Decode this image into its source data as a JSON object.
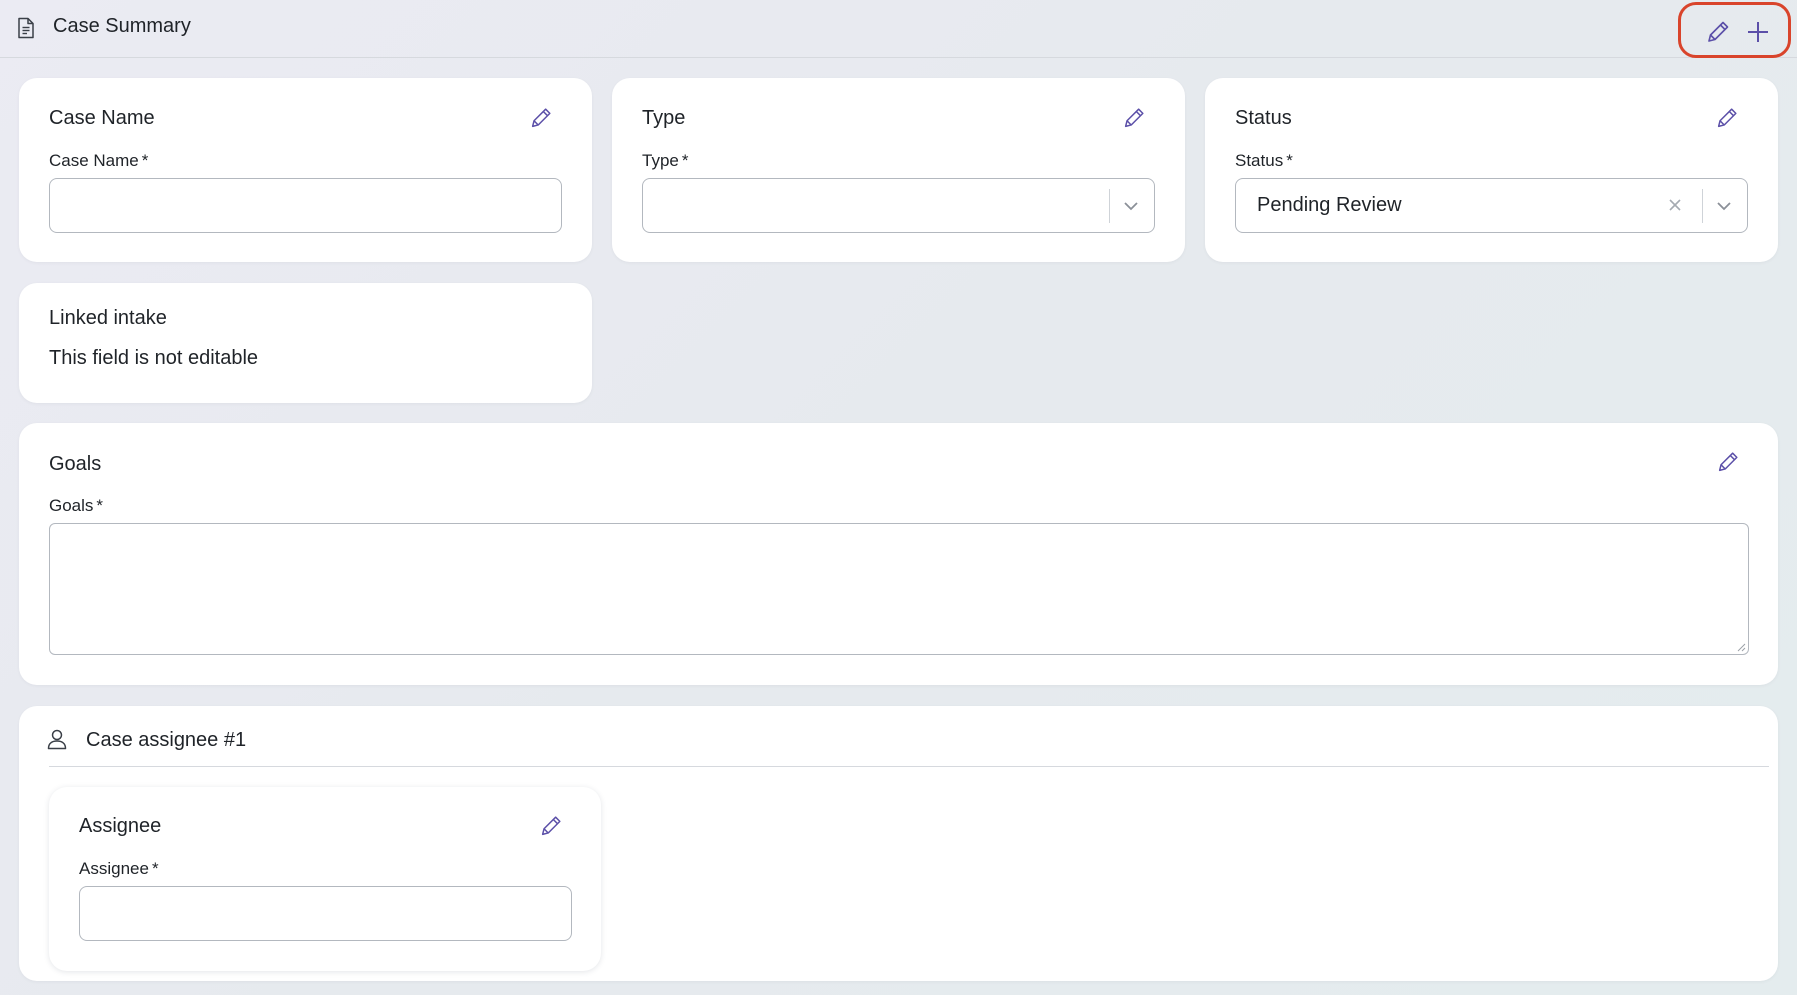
{
  "header": {
    "title": "Case Summary",
    "icons": {
      "document": "document-icon",
      "edit": "pencil-icon",
      "add": "plus-icon"
    }
  },
  "cards": {
    "case_name": {
      "title": "Case Name",
      "label": "Case Name",
      "required": "*",
      "value": ""
    },
    "type": {
      "title": "Type",
      "label": "Type",
      "required": "*",
      "value": ""
    },
    "status": {
      "title": "Status",
      "label": "Status",
      "required": "*",
      "value": "Pending Review"
    },
    "linked_intake": {
      "title": "Linked intake",
      "text": "This field is not editable"
    },
    "goals": {
      "title": "Goals",
      "label": "Goals",
      "required": "*",
      "value": ""
    }
  },
  "assignee_section": {
    "title": "Case assignee #1",
    "card": {
      "title": "Assignee",
      "label": "Assignee",
      "required": "*",
      "value": ""
    }
  },
  "colors": {
    "accent": "#5b4fa8",
    "highlight": "#d9442b",
    "border": "#b3b8bf"
  }
}
